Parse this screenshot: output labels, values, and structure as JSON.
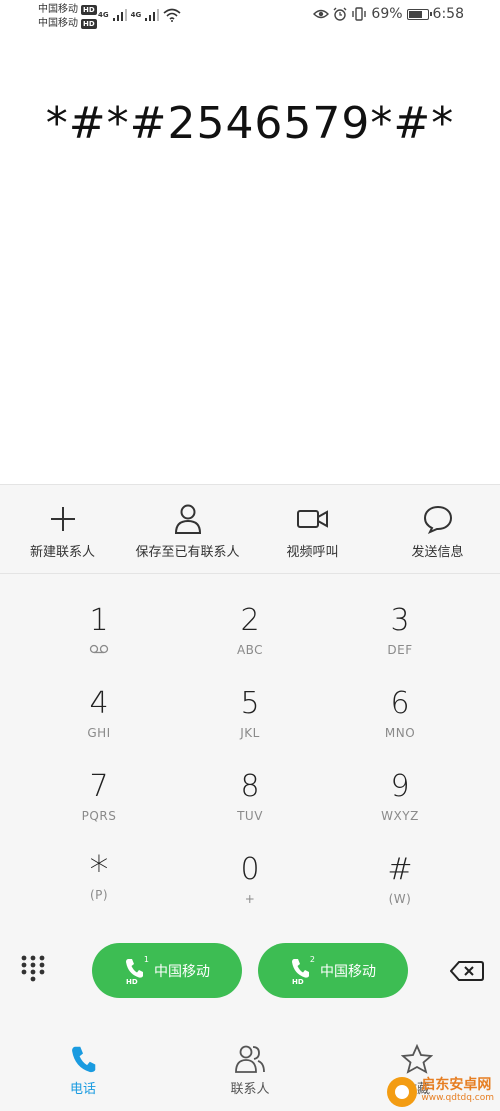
{
  "status_bar": {
    "carrier_1": "中国移动",
    "carrier_2": "中国移动",
    "hd_label": "HD",
    "network_1": "4G",
    "network_2": "4G",
    "battery_percent": "69%",
    "battery_level": 0.69,
    "time": "6:58",
    "icons": [
      "eye-icon",
      "alarm-icon",
      "vibrate-icon",
      "battery-icon",
      "signal-icon",
      "wifi-icon"
    ]
  },
  "dialer": {
    "number": "*#*#2546579*#*"
  },
  "actions": [
    {
      "label": "新建联系人",
      "icon": "plus-icon"
    },
    {
      "label": "保存至已有联系人",
      "icon": "person-icon"
    },
    {
      "label": "视频呼叫",
      "icon": "video-icon"
    },
    {
      "label": "发送信息",
      "icon": "message-icon"
    }
  ],
  "keypad": [
    {
      "digit": "1",
      "sub": "voicemail-icon"
    },
    {
      "digit": "2",
      "sub": "ABC"
    },
    {
      "digit": "3",
      "sub": "DEF"
    },
    {
      "digit": "4",
      "sub": "GHI"
    },
    {
      "digit": "5",
      "sub": "JKL"
    },
    {
      "digit": "6",
      "sub": "MNO"
    },
    {
      "digit": "7",
      "sub": "PQRS"
    },
    {
      "digit": "8",
      "sub": "TUV"
    },
    {
      "digit": "9",
      "sub": "WXYZ"
    },
    {
      "digit": "*",
      "sub": "(P)"
    },
    {
      "digit": "0",
      "sub": "+"
    },
    {
      "digit": "#",
      "sub": "(W)"
    }
  ],
  "call_buttons": [
    {
      "sim": "1",
      "hd": "HD",
      "label": "中国移动"
    },
    {
      "sim": "2",
      "hd": "HD",
      "label": "中国移动"
    }
  ],
  "tabs": [
    {
      "label": "电话",
      "icon": "phone-icon",
      "active": true
    },
    {
      "label": "联系人",
      "icon": "contacts-icon",
      "active": false
    },
    {
      "label": "收藏",
      "icon": "star-icon",
      "active": false
    }
  ],
  "watermark": {
    "title": "启东安卓网",
    "url": "www.qdtdq.com"
  },
  "colors": {
    "call_green": "#3dbd53",
    "active_tab": "#1a9be0",
    "inactive_tab": "#555555"
  }
}
